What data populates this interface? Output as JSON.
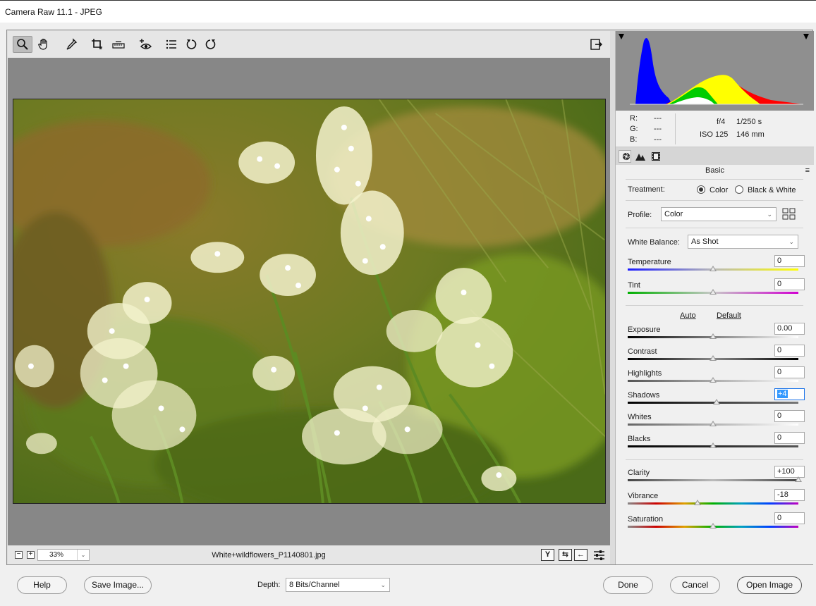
{
  "window": {
    "title": "Camera Raw 11.1  -  JPEG"
  },
  "toolbar": {
    "tools": [
      "zoom-tool",
      "hand-tool",
      "white-balance-tool",
      "crop-tool",
      "straighten-tool",
      "red-eye-tool",
      "presets-tool",
      "rotate-ccw-tool",
      "rotate-cw-tool"
    ],
    "open_prefs": "filmstrip-toggle"
  },
  "preview": {
    "zoom_minus": "−",
    "zoom_plus": "+",
    "zoom_value": "33%",
    "filename": "White+wildflowers_P1140801.jpg",
    "btn_y": "Y",
    "btn_swap": "⇆",
    "btn_back": "←",
    "btn_settings": "≡"
  },
  "histogram": {
    "clip_left": "shadow-clipping-warning",
    "clip_right": "highlight-clipping-warning"
  },
  "info": {
    "r_label": "R:",
    "r_value": "---",
    "g_label": "G:",
    "g_value": "---",
    "b_label": "B:",
    "b_value": "---",
    "aperture": "f/4",
    "shutter": "1/250 s",
    "iso": "ISO 125",
    "focal": "146 mm"
  },
  "panel": {
    "title": "Basic",
    "menu": "≡",
    "treatment_label": "Treatment:",
    "treatment_color": "Color",
    "treatment_bw": "Black & White",
    "profile_label": "Profile:",
    "profile_value": "Color",
    "wb_label": "White Balance:",
    "wb_value": "As Shot",
    "auto": "Auto",
    "default": "Default",
    "sliders": [
      {
        "label": "Temperature",
        "value": "0",
        "pos": 0.5
      },
      {
        "label": "Tint",
        "value": "0",
        "pos": 0.5
      },
      {
        "label": "Exposure",
        "value": "0.00",
        "pos": 0.5
      },
      {
        "label": "Contrast",
        "value": "0",
        "pos": 0.5
      },
      {
        "label": "Highlights",
        "value": "0",
        "pos": 0.5
      },
      {
        "label": "Shadows",
        "value": "+4",
        "pos": 0.52
      },
      {
        "label": "Whites",
        "value": "0",
        "pos": 0.5
      },
      {
        "label": "Blacks",
        "value": "0",
        "pos": 0.5
      },
      {
        "label": "Clarity",
        "value": "+100",
        "pos": 1.0
      },
      {
        "label": "Vibrance",
        "value": "-18",
        "pos": 0.41
      },
      {
        "label": "Saturation",
        "value": "0",
        "pos": 0.5
      }
    ]
  },
  "footer": {
    "help": "Help",
    "save": "Save Image...",
    "depth_label": "Depth:",
    "depth_value": "8 Bits/Channel",
    "done": "Done",
    "cancel": "Cancel",
    "open": "Open Image"
  },
  "colors": {
    "accent_focus": "#3399ff",
    "canvas_gray": "#878787"
  }
}
